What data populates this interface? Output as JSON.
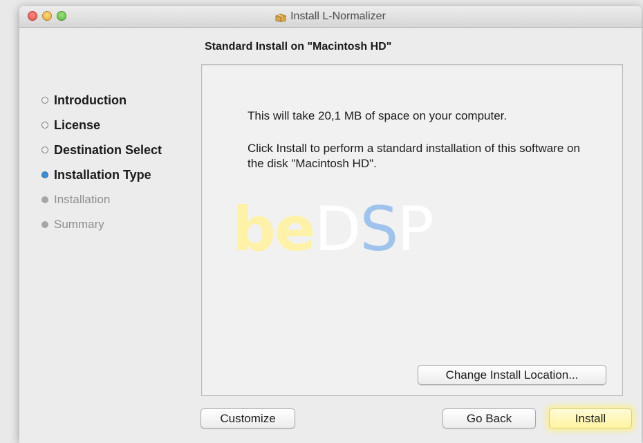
{
  "window": {
    "title": "Install L-Normalizer",
    "icon": "package-icon"
  },
  "header": {
    "title": "Standard Install on \"Macintosh HD\""
  },
  "steps": [
    {
      "label": "Introduction",
      "state": "done"
    },
    {
      "label": "License",
      "state": "done"
    },
    {
      "label": "Destination Select",
      "state": "done"
    },
    {
      "label": "Installation Type",
      "state": "current"
    },
    {
      "label": "Installation",
      "state": "pending"
    },
    {
      "label": "Summary",
      "state": "pending"
    }
  ],
  "content": {
    "space_message": "This will take 20,1 MB of space on your computer.",
    "install_message": "Click Install to perform a standard installation of this software on the disk \"Macintosh HD\".",
    "watermark": {
      "part1": "be",
      "part2": "D",
      "part3": "S",
      "part4": "P"
    }
  },
  "buttons": {
    "change_location": "Change Install Location...",
    "customize": "Customize",
    "go_back": "Go Back",
    "install": "Install"
  },
  "colors": {
    "current_step": "#3b8fd9",
    "install_highlight": "#fff3a0",
    "watermark_yellow": "#fff2a8",
    "watermark_blue": "#9fc3ec"
  }
}
